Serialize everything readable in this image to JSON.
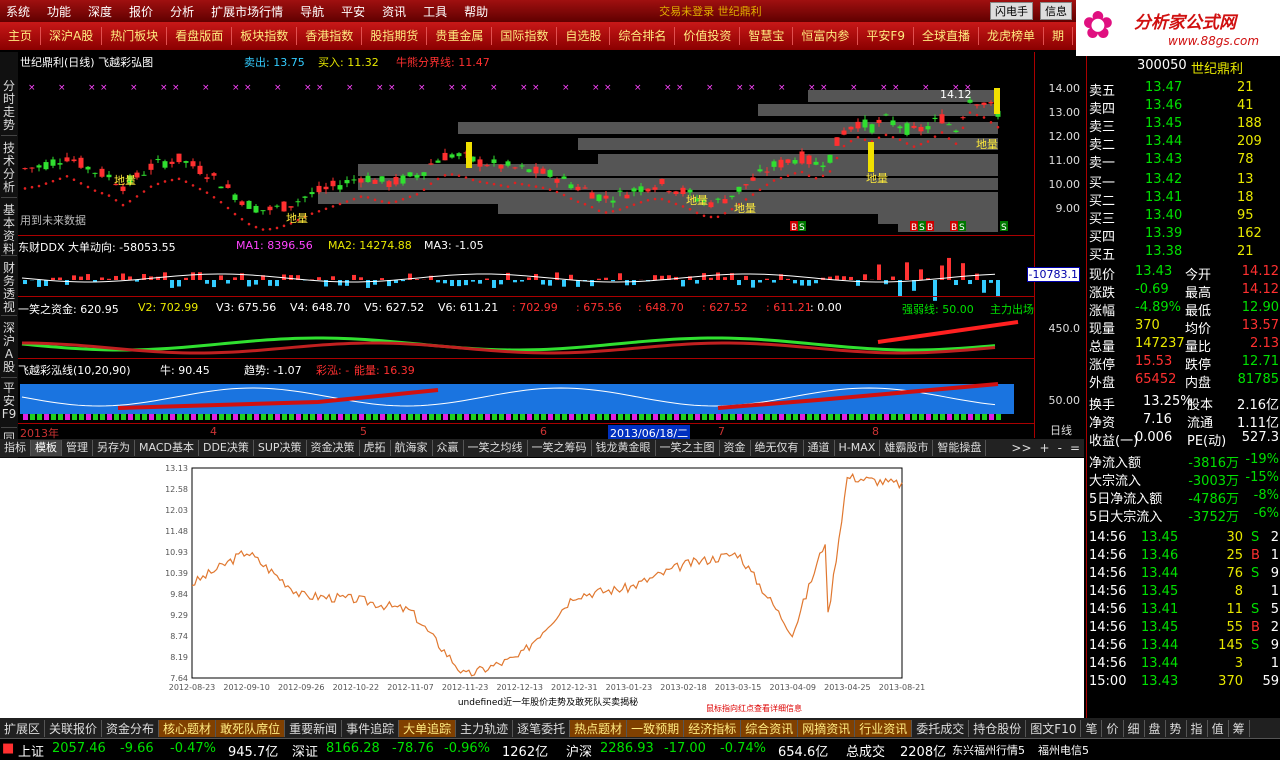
{
  "menu": {
    "items": [
      "系统",
      "功能",
      "深度",
      "报价",
      "分析",
      "扩展市场行情",
      "导航",
      "平安",
      "资讯",
      "工具",
      "帮助"
    ],
    "notice": "交易未登录  世纪鼎利",
    "btn1": "闪电手",
    "btn2": "信息"
  },
  "logo": {
    "name": "分析家公式网",
    "url": "www.88gs.com"
  },
  "tabs": [
    "主页",
    "深沪A股",
    "热门板块",
    "看盘版面",
    "板块指数",
    "香港指数",
    "股指期货",
    "贵重金属",
    "国际指数",
    "自选股",
    "综合排名",
    "价值投资",
    "智慧宝",
    "恒富内参",
    "平安F9",
    "全球直播",
    "龙虎榜单",
    "期"
  ],
  "sidebar": [
    "分时走势",
    "技术分析",
    "基本资料",
    "财务透视",
    "深沪A股",
    "平安F9",
    "同"
  ],
  "chart": {
    "main_title": "世纪鼎利(日线) 飞越彩弘图",
    "main_sell": "卖出: 13.75",
    "main_buy": "买入: 11.32",
    "main_bull": "牛熊分界线: 11.47",
    "price_label": "14.12",
    "future_note": "用到未来数据",
    "low_label": "地量",
    "ddx_title": "东财DDX 大单动向: -58053.55",
    "ddx_ma1": "MA1: 8396.56",
    "ddx_ma2": "MA2: 14274.88",
    "ddx_ma3": "MA3: -1.05",
    "ddx_val": "-10783.1",
    "yx_title": "一笑之资金: 620.95",
    "yx_v2": "V2: 702.99",
    "yx_v3": "V3: 675.56",
    "yx_v4": "V4: 648.70",
    "yx_v5": "V5: 627.52",
    "yx_v6": "V6: 611.21",
    "yx_r1": ": 702.99",
    "yx_r2": ": 675.56",
    "yx_r3": ": 648.70",
    "yx_r4": ": 627.52",
    "yx_r5": ": 611.21",
    "yx_r6": ": 0.00",
    "yx_strength": "强弱线: 50.00",
    "yx_main": "主力出场",
    "fl_title": "飞越彩泓线(10,20,90)",
    "fl_bull": "牛: 90.45",
    "fl_trend": "趋势: -1.07",
    "fl_color": "彩泓: -",
    "fl_energy": "能量: 16.39",
    "axis_main": [
      "14.00",
      "13.00",
      "12.00",
      "11.00",
      "10.00",
      "9.00"
    ],
    "axis_yx": "450.0",
    "axis_fl": "50.00",
    "dates": [
      "2013年",
      "4",
      "5",
      "6",
      "2013/06/18/二",
      "7",
      "8"
    ],
    "period": "日线"
  },
  "bottom_tabs": [
    "指标",
    "模板",
    "管理",
    "另存为",
    "MACD基本",
    "DDE决策",
    "SUP决策",
    "资金决策",
    "虎拓",
    "航海家",
    "众赢",
    "一笑之均线",
    "一笑之筹码",
    "钱龙黄金眼",
    "一笑之主图",
    "资金",
    "绝无仅有",
    "通道",
    "H-MAX",
    "雄霸股市",
    "智能操盘"
  ],
  "bottom_right": [
    ">>",
    "+",
    "-",
    "="
  ],
  "webchart": {
    "title": "undefined近一年股价走势及敢死队买卖揭秘",
    "note": "鼠标指向红点查看详细信息",
    "accent": "#e07830",
    "yticks": [
      "13.13",
      "12.58",
      "12.03",
      "11.48",
      "10.93",
      "10.39",
      "9.84",
      "9.29",
      "8.74",
      "8.19",
      "7.64"
    ],
    "xticks": [
      "2012-08-23",
      "2012-09-10",
      "2012-09-26",
      "2012-10-22",
      "2012-11-07",
      "2012-11-23",
      "2012-12-13",
      "2012-12-31",
      "2013-01-23",
      "2013-02-18",
      "2013-03-15",
      "2013-04-09",
      "2013-04-25",
      "2013-08-21"
    ]
  },
  "chart_data": {
    "type": "line",
    "title": "undefined近一年股价走势及敢死队买卖揭秘",
    "xlabel": "",
    "ylabel": "",
    "ylim": [
      7.64,
      13.13
    ],
    "categories": [
      "2012-08-23",
      "2012-09-10",
      "2012-09-26",
      "2012-10-22",
      "2012-11-07",
      "2012-11-23",
      "2012-12-13",
      "2012-12-31",
      "2013-01-23",
      "2013-02-18",
      "2013-03-15",
      "2013-04-09",
      "2013-04-25",
      "2013-08-21"
    ],
    "values": [
      10.1,
      10.95,
      9.8,
      9.7,
      9.4,
      7.7,
      8.2,
      9.8,
      10.0,
      10.6,
      10.9,
      8.8,
      12.9,
      12.7
    ]
  },
  "panel": {
    "code": "300050",
    "name": "世纪鼎利",
    "asks": [
      {
        "l": "卖五",
        "p": "13.47",
        "v": "21"
      },
      {
        "l": "卖四",
        "p": "13.46",
        "v": "41"
      },
      {
        "l": "卖三",
        "p": "13.45",
        "v": "188"
      },
      {
        "l": "卖二",
        "p": "13.44",
        "v": "209"
      },
      {
        "l": "卖一",
        "p": "13.43",
        "v": "78"
      }
    ],
    "bids": [
      {
        "l": "买一",
        "p": "13.42",
        "v": "13"
      },
      {
        "l": "买二",
        "p": "13.41",
        "v": "18"
      },
      {
        "l": "买三",
        "p": "13.40",
        "v": "95"
      },
      {
        "l": "买四",
        "p": "13.39",
        "v": "162"
      },
      {
        "l": "买五",
        "p": "13.38",
        "v": "21"
      }
    ],
    "stats": [
      {
        "a": "现价",
        "av": "13.43",
        "b": "今开",
        "bv": "14.12"
      },
      {
        "a": "涨跌",
        "av": "-0.69",
        "b": "最高",
        "bv": "14.12"
      },
      {
        "a": "涨幅",
        "av": "-4.89%",
        "b": "最低",
        "bv": "12.90"
      },
      {
        "a": "现量",
        "av": "370",
        "b": "均价",
        "bv": "13.57"
      },
      {
        "a": "总量",
        "av": "147237",
        "b": "量比",
        "bv": "2.13"
      },
      {
        "a": "涨停",
        "av": "15.53",
        "b": "跌停",
        "bv": "12.71"
      },
      {
        "a": "外盘",
        "av": "65452",
        "b": "内盘",
        "bv": "81785"
      }
    ],
    "stats2": [
      {
        "a": "换手",
        "av": "13.25%",
        "b": "股本",
        "bv": "2.16亿"
      },
      {
        "a": "净资",
        "av": "7.16",
        "b": "流通",
        "bv": "1.11亿"
      },
      {
        "a": "收益(一)",
        "av": "0.006",
        "b": "PE(动)",
        "bv": "527.3"
      }
    ],
    "flows": [
      {
        "l": "净流入额",
        "v": "-3816万",
        "p": "-19%"
      },
      {
        "l": "大宗流入",
        "v": "-3003万",
        "p": "-15%"
      },
      {
        "l": "5日净流入额",
        "v": "-4786万",
        "p": "-8%"
      },
      {
        "l": "5日大宗流入",
        "v": "-3752万",
        "p": "-6%"
      }
    ],
    "ticks": [
      {
        "t": "14:56",
        "p": "13.45",
        "v": "30",
        "s": "S",
        "n": "2"
      },
      {
        "t": "14:56",
        "p": "13.46",
        "v": "25",
        "s": "B",
        "n": "1"
      },
      {
        "t": "14:56",
        "p": "13.44",
        "v": "76",
        "s": "S",
        "n": "9"
      },
      {
        "t": "14:56",
        "p": "13.45",
        "v": "8",
        "s": "",
        "n": "1"
      },
      {
        "t": "14:56",
        "p": "13.41",
        "v": "11",
        "s": "S",
        "n": "5"
      },
      {
        "t": "14:56",
        "p": "13.45",
        "v": "55",
        "s": "B",
        "n": "2"
      },
      {
        "t": "14:56",
        "p": "13.44",
        "v": "145",
        "s": "S",
        "n": "9"
      },
      {
        "t": "14:56",
        "p": "13.44",
        "v": "3",
        "s": "",
        "n": "1"
      },
      {
        "t": "15:00",
        "p": "13.43",
        "v": "370",
        "s": "",
        "n": "59"
      }
    ]
  },
  "bottombar1": [
    "扩展区",
    "关联报价",
    "资金分布",
    "核心题材",
    "敢死队席位",
    "重要新闻",
    "事件追踪",
    "大单追踪",
    "主力轨迹",
    "逐笔委托",
    "热点题材",
    "一致预期",
    "经济指标",
    "综合资讯",
    "网摘资讯",
    "行业资讯",
    "委托成交",
    "持仓股份",
    "图文F10",
    "笔",
    "价",
    "细",
    "盘",
    "势",
    "指",
    "值",
    "筹"
  ],
  "bottombar2": {
    "sh_label": "上证",
    "sh": "2057.46",
    "sh_chg": "-9.66",
    "sh_pct": "-0.47%",
    "sh_amt": "945.7亿",
    "sz_label": "深证",
    "sz": "8166.28",
    "sz_chg": "-78.76",
    "sz_pct": "-0.96%",
    "sz_amt": "1262亿",
    "hs_label": "沪深",
    "hs": "2286.93",
    "hs_chg": "-17.00",
    "hs_pct": "-0.74%",
    "hs_amt": "654.6亿",
    "total_label": "总成交",
    "total": "2208亿",
    "server": "东兴福州行情5",
    "server2": "福州电信5"
  }
}
